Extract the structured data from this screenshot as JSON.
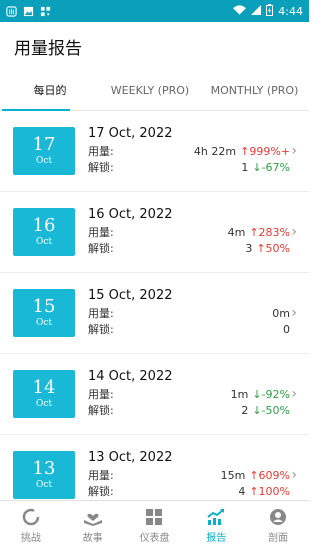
{
  "status_bar": {
    "time": "4:44"
  },
  "header": {
    "title": "用量报告"
  },
  "tabs": [
    {
      "label": "每日的",
      "active": true
    },
    {
      "label": "WEEKLY (PRO)",
      "active": false
    },
    {
      "label": "MONTHLY (PRO)",
      "active": false
    }
  ],
  "labels": {
    "usage": "用量:",
    "unlock": "解锁:"
  },
  "rows": [
    {
      "day": "17",
      "month": "Oct",
      "date": "17 Oct, 2022",
      "usage": "4h 22m",
      "usage_change": "999%+",
      "usage_dir": "up",
      "unlocks": "1",
      "unlock_change": "-67%",
      "unlock_dir": "down"
    },
    {
      "day": "16",
      "month": "Oct",
      "date": "16 Oct, 2022",
      "usage": "4m",
      "usage_change": "283%",
      "usage_dir": "up",
      "unlocks": "3",
      "unlock_change": "50%",
      "unlock_dir": "up"
    },
    {
      "day": "15",
      "month": "Oct",
      "date": "15 Oct, 2022",
      "usage": "0m",
      "usage_change": "",
      "usage_dir": "",
      "unlocks": "0",
      "unlock_change": "",
      "unlock_dir": ""
    },
    {
      "day": "14",
      "month": "Oct",
      "date": "14 Oct, 2022",
      "usage": "1m",
      "usage_change": "-92%",
      "usage_dir": "down",
      "unlocks": "2",
      "unlock_change": "-50%",
      "unlock_dir": "down"
    },
    {
      "day": "13",
      "month": "Oct",
      "date": "13 Oct, 2022",
      "usage": "15m",
      "usage_change": "609%",
      "usage_dir": "up",
      "unlocks": "4",
      "unlock_change": "100%",
      "unlock_dir": "up"
    }
  ],
  "nav": [
    {
      "label": "挑战",
      "icon": "ring-icon",
      "active": false
    },
    {
      "label": "故事",
      "icon": "book-heart-icon",
      "active": false
    },
    {
      "label": "仪表盘",
      "icon": "dashboard-icon",
      "active": false
    },
    {
      "label": "报告",
      "icon": "trend-chart-icon",
      "active": true
    },
    {
      "label": "剖面",
      "icon": "profile-icon",
      "active": false
    }
  ],
  "colors": {
    "accent": "#0ab0c9",
    "status_bar": "#0a9fba",
    "date_box": "#19b8d6",
    "up": "#e53935",
    "down": "#2e9e48"
  }
}
